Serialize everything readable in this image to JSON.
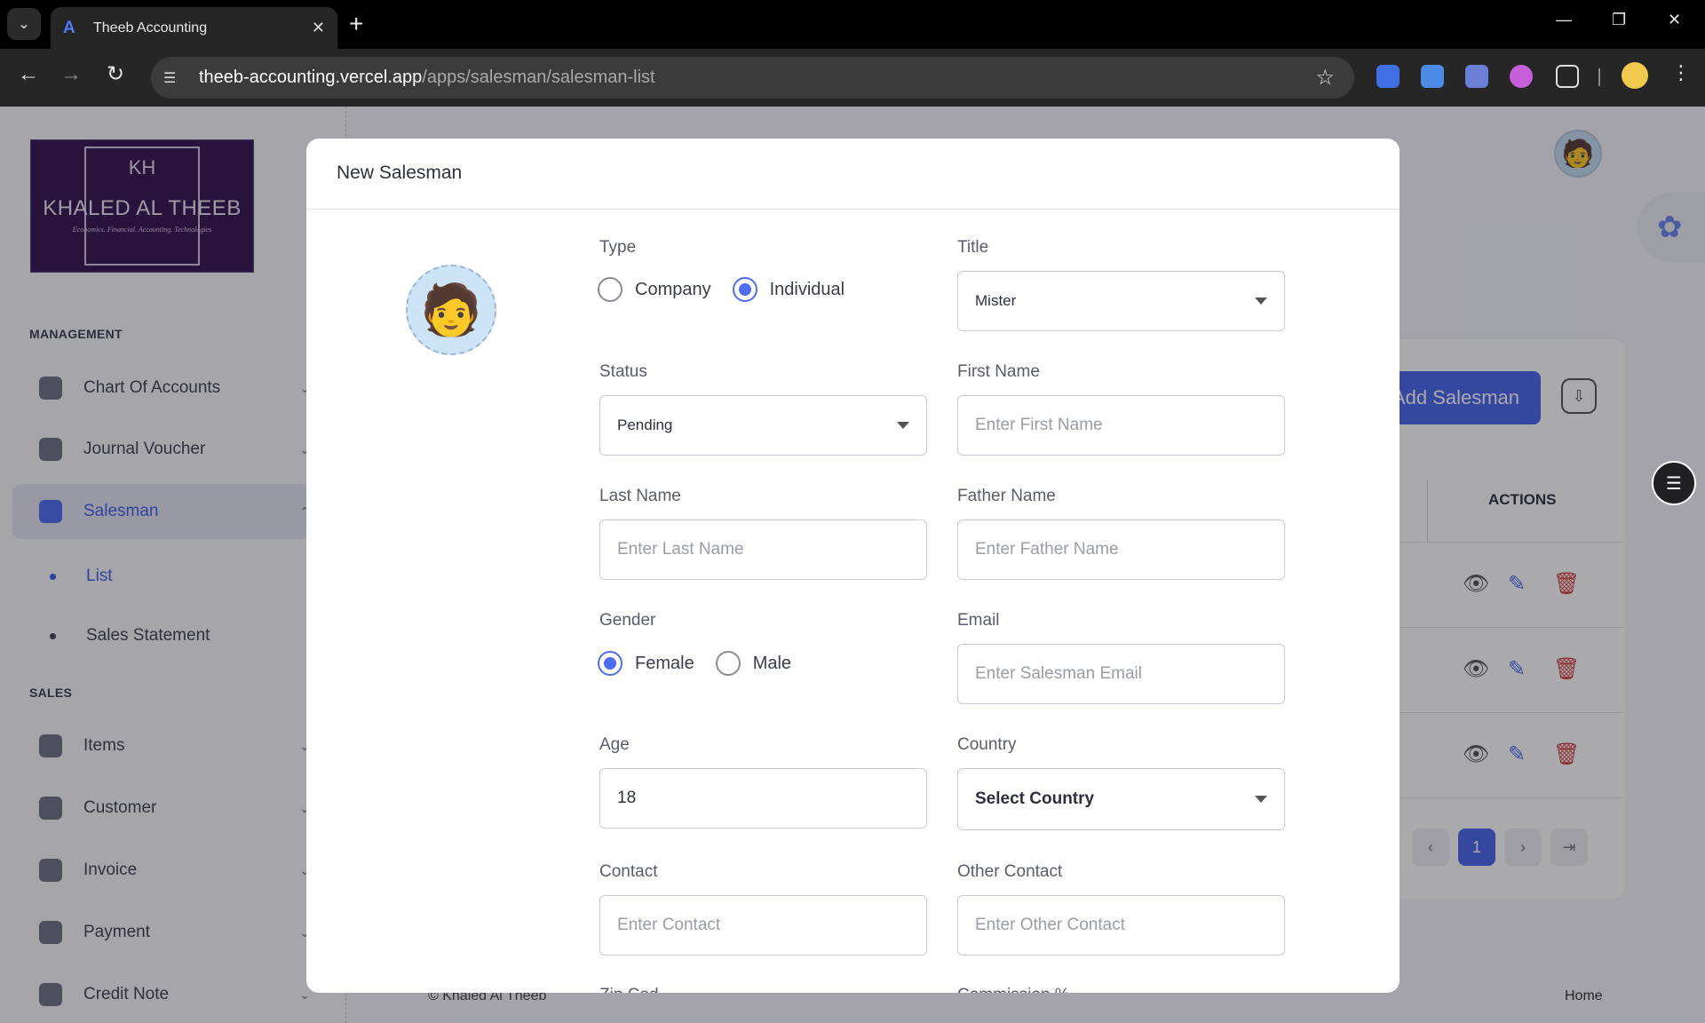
{
  "browser": {
    "tab_title": "Theeb Accounting",
    "url_host": "theeb-accounting.vercel.app",
    "url_path": "/apps/salesman/salesman-list"
  },
  "sidebar": {
    "logo_text": "KHALED AL THEEB",
    "logo_mark": "KH",
    "logo_subtitle": "Economics. Financial. Accounting. Technologies",
    "management_title": "MANAGEMENT",
    "sales_title": "SALES",
    "management_items": [
      {
        "label": "Chart Of Accounts"
      },
      {
        "label": "Journal Voucher"
      },
      {
        "label": "Salesman"
      }
    ],
    "salesman_sub": [
      {
        "label": "List"
      },
      {
        "label": "Sales Statement"
      }
    ],
    "sales_items": [
      {
        "label": "Items"
      },
      {
        "label": "Customer"
      },
      {
        "label": "Invoice"
      },
      {
        "label": "Payment"
      },
      {
        "label": "Credit Note"
      }
    ]
  },
  "page": {
    "add_button": "Add Salesman",
    "actions_header": "ACTIONS",
    "current_page": "1",
    "footer_copy": "© Khaled Al Theeb",
    "footer_home": "Home"
  },
  "modal": {
    "title": "New Salesman",
    "type_label": "Type",
    "type_options": [
      "Company",
      "Individual"
    ],
    "type_selected": "Individual",
    "title_label": "Title",
    "title_value": "Mister",
    "status_label": "Status",
    "status_value": "Pending",
    "first_name_label": "First Name",
    "first_name_placeholder": "Enter First Name",
    "last_name_label": "Last Name",
    "last_name_placeholder": "Enter Last Name",
    "father_name_label": "Father Name",
    "father_name_placeholder": "Enter Father Name",
    "gender_label": "Gender",
    "gender_options": [
      "Female",
      "Male"
    ],
    "gender_selected": "Female",
    "email_label": "Email",
    "email_placeholder": "Enter Salesman Email",
    "age_label": "Age",
    "age_value": "18",
    "country_label": "Country",
    "country_value": "Select Country",
    "contact_label": "Contact",
    "contact_placeholder": "Enter Contact",
    "other_contact_label": "Other Contact",
    "other_contact_placeholder": "Enter Other Contact",
    "zip_label_partial": "Zip Cod",
    "commission_label_partial": "Commission %"
  },
  "colors": {
    "accent": "#4f6df0",
    "primary_button": "#4865e8",
    "delete": "#d23c3c"
  }
}
